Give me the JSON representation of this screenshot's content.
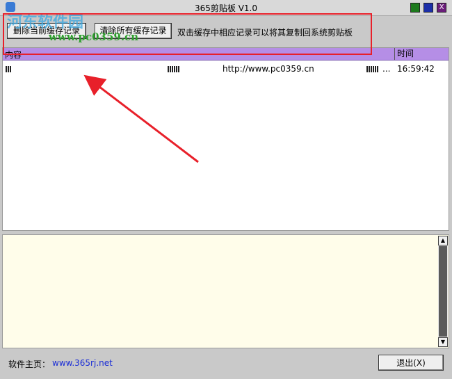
{
  "window": {
    "title": "365剪贴板 V1.0",
    "min_label": "",
    "max_label": "",
    "close_label": "X"
  },
  "watermark": {
    "text": "河东软件园",
    "url": "www.pc0359.cn"
  },
  "toolbar": {
    "delete_current_label": "删除当前缓存记录",
    "clear_all_label": "清除所有缓存记录",
    "hint": "双击缓存中相应记录可以将其复制回系统剪贴板"
  },
  "list": {
    "headers": {
      "content": "内容",
      "time": "时间"
    },
    "rows": [
      {
        "url": "http://www.pc0359.cn",
        "dots": "...",
        "time": "16:59:42"
      }
    ]
  },
  "footer": {
    "homepage_label": "软件主页：",
    "homepage_url": "www.365rj.net",
    "exit_label": "退出(X)"
  },
  "colors": {
    "header_bg": "#b58ee6",
    "detail_bg": "#fffdea",
    "highlight": "#e8202a",
    "link": "#1a2dd6"
  }
}
